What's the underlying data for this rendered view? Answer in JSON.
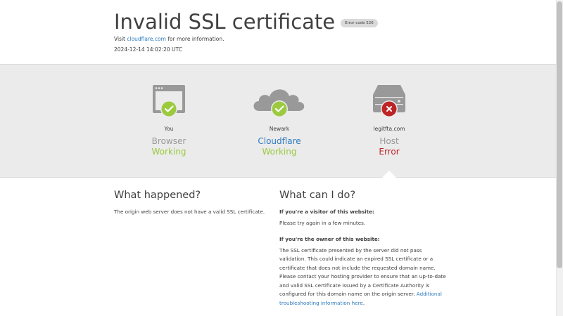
{
  "header": {
    "title": "Invalid SSL certificate",
    "badge": "Error code 526",
    "visit_prefix": "Visit ",
    "visit_link": "cloudflare.com",
    "visit_suffix": " for more information.",
    "timestamp": "2024-12-14 14:02:20 UTC"
  },
  "nodes": [
    {
      "location": "You",
      "role": "Browser",
      "status": "Working",
      "status_type": "ok",
      "icon": "browser-icon"
    },
    {
      "location": "Newark",
      "role": "Cloudflare",
      "status": "Working",
      "status_type": "ok",
      "icon": "cloud-icon"
    },
    {
      "location": "legitfta.com",
      "role": "Host",
      "status": "Error",
      "status_type": "error",
      "icon": "server-icon"
    }
  ],
  "what_happened": {
    "heading": "What happened?",
    "text": "The origin web server does not have a valid SSL certificate."
  },
  "what_can_i_do": {
    "heading": "What can I do?",
    "visitor_heading": "If you're a visitor of this website:",
    "visitor_text": "Please try again in a few minutes.",
    "owner_heading": "If you're the owner of this website:",
    "owner_text": "The SSL certificate presented by the server did not pass validation. This could indicate an expired SSL certificate or a certificate that does not include the requested domain name. Please contact your hosting provider to ensure that an up-to-date and valid SSL certificate issued by a Certificate Authority is configured for this domain name on the origin server.",
    "owner_link": "Additional troubleshooting information here",
    "owner_link_suffix": "."
  },
  "colors": {
    "ok": "#9bca3e",
    "error": "#bd2426",
    "link": "#2f7bbf",
    "icon_gray": "#999999"
  }
}
